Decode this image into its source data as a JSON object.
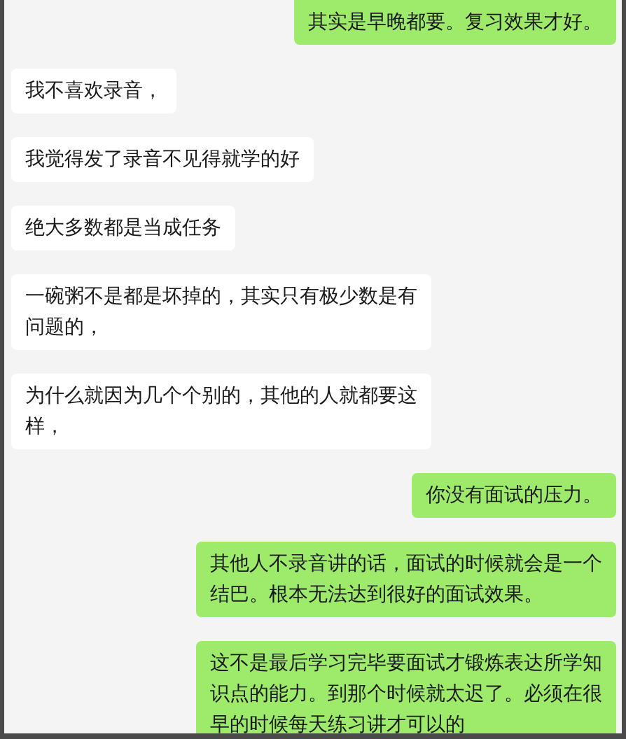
{
  "messages": [
    {
      "kind": "sent",
      "text": "其实是早晚都要。复习效果才好。"
    },
    {
      "kind": "received",
      "text": "我不喜欢录音，"
    },
    {
      "kind": "received",
      "text": "我觉得发了录音不见得就学的好"
    },
    {
      "kind": "received",
      "text": "绝大多数都是当成任务"
    },
    {
      "kind": "received",
      "text": "一碗粥不是都是坏掉的，其实只有极少数是有问题的，"
    },
    {
      "kind": "received",
      "text": "为什么就因为几个个别的，其他的人就都要这样，"
    },
    {
      "kind": "sent",
      "text": "你没有面试的压力。"
    },
    {
      "kind": "sent",
      "text": "其他人不录音讲的话，面试的时候就会是一个结巴。根本无法达到很好的面试效果。"
    },
    {
      "kind": "sent",
      "text": "这不是最后学习完毕要面试才锻炼表达所学知识点的能力。到那个时候就太迟了。必须在很早的时候每天练习讲才可以的"
    }
  ]
}
